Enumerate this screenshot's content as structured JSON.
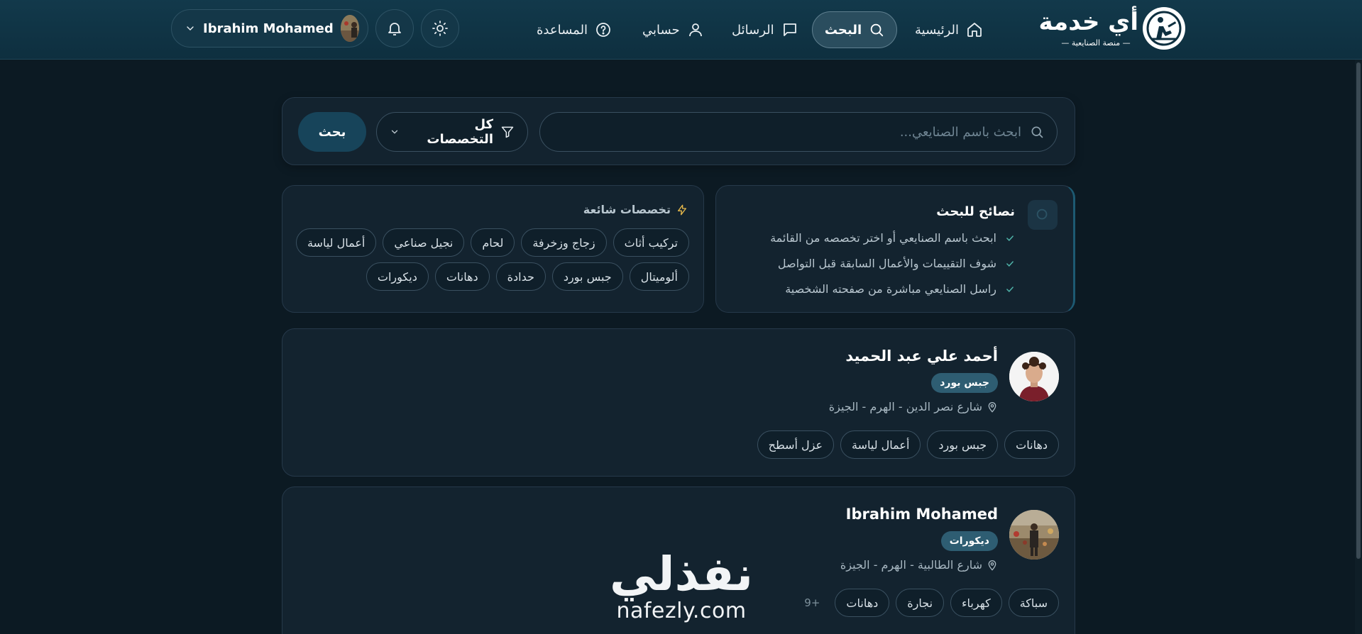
{
  "brand": {
    "title": "أي خدمة",
    "subtitle": "— منصة الصنايعية —"
  },
  "nav": {
    "home": "الرئيسية",
    "search": "البحث",
    "messages": "الرسائل",
    "account": "حسابي",
    "help": "المساعدة"
  },
  "user": {
    "name": "Ibrahim Mohamed"
  },
  "search": {
    "placeholder": "ابحث باسم الصنايعي...",
    "filter_value": "كل التخصصات",
    "button_label": "بحث"
  },
  "tips": {
    "title": "نصائح للبحث",
    "items": [
      "ابحث باسم الصنايعي أو اختر تخصصه من القائمة",
      "شوف التقييمات والأعمال السابقة قبل التواصل",
      "راسل الصنايعي مباشرة من صفحته الشخصية"
    ]
  },
  "popular": {
    "title": "تخصصات شائعة",
    "row1": [
      "تركيب أثاث",
      "زجاج وزخرفة",
      "لحام",
      "نجيل صناعي",
      "أعمال لياسة"
    ],
    "row2": [
      "ألوميتال",
      "جبس بورد",
      "حدادة",
      "دهانات",
      "ديكورات"
    ]
  },
  "workers": [
    {
      "name": "أحمد علي عبد الحميد",
      "specialty": "جبس بورد",
      "location": "شارع نصر الدين - الهرم - الجيزة",
      "skills": [
        "دهانات",
        "جبس بورد",
        "أعمال لياسة",
        "عزل أسطح"
      ],
      "more": ""
    },
    {
      "name": "Ibrahim Mohamed",
      "specialty": "ديكورات",
      "location": "شارع الطالبية - الهرم - الجيزة",
      "skills": [
        "سباكة",
        "كهرباء",
        "نجارة",
        "دهانات"
      ],
      "more": "+9"
    }
  ],
  "watermark": {
    "arabic": "نفذلي",
    "latin": "nafezly.com"
  },
  "colors": {
    "background": "#0c1a23",
    "navbar": "#12394b",
    "panel": "#13232f",
    "accent_button": "#17445a",
    "badge": "#2e5d72",
    "check": "#4fb3a9",
    "bolt": "#e6b84a"
  }
}
